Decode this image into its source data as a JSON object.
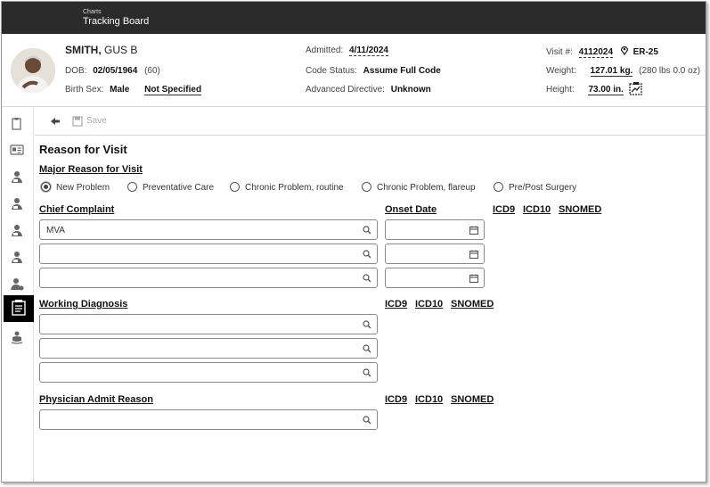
{
  "topbar": {
    "breadcrumb": "Charts",
    "title": "Tracking Board"
  },
  "patient": {
    "last_name": "SMITH,",
    "first_name": " GUS B",
    "dob_label": "DOB:",
    "dob": "02/05/1964",
    "age": "(60)",
    "birth_sex_label": "Birth Sex:",
    "birth_sex": "Male",
    "gender_identity": "Not Specified",
    "admitted_label": "Admitted:",
    "admitted": "4/11/2024",
    "code_status_label": "Code Status:",
    "code_status": "Assume Full Code",
    "advanced_directive_label": "Advanced Directive:",
    "advanced_directive": "Unknown",
    "visit_label": "Visit #:",
    "visit": "4112024",
    "location": "ER-25",
    "weight_label": "Weight:",
    "weight": "127.01 kg.",
    "weight_alt": "(280 lbs 0.0 oz)",
    "height_label": "Height:",
    "height": "73.00 in."
  },
  "toolbar": {
    "save_label": "Save"
  },
  "form": {
    "title": "Reason for Visit",
    "major_reason_label": "Major Reason for Visit",
    "major_reason_options": [
      "New Problem",
      "Preventative Care",
      "Chronic Problem, routine",
      "Chronic Problem, flareup",
      "Pre/Post Surgery"
    ],
    "major_reason_selected": "New Problem",
    "chief_complaint_label": "Chief Complaint",
    "onset_date_label": "Onset Date",
    "chief_complaints": [
      "MVA",
      "",
      ""
    ],
    "working_diagnosis_label": "Working Diagnosis",
    "physician_admit_reason_label": "Physician Admit Reason",
    "code_links": {
      "icd9": "ICD9",
      "icd10": "ICD10",
      "snomed": "SNOMED"
    }
  },
  "colors": {
    "topbar_bg": "#2b2b2b",
    "text": "#222222",
    "border": "#8a8a8a"
  }
}
